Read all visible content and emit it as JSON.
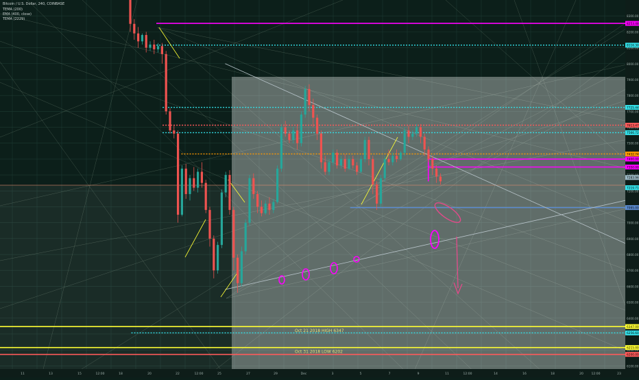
{
  "header": {
    "symbol_line": "Bitcoin / U.S. Dollar, 240, COINBASE",
    "indicators": [
      "TEMA (200)",
      "EMA (400, close)",
      "TEMA (2229)"
    ]
  },
  "colors": {
    "background": "#0c1f1a",
    "up": "#26a69a",
    "down": "#ef5350",
    "magenta": "#ff00ff",
    "cyan": "#33e0e8",
    "yellow": "#ffff33",
    "orange": "#ff9900",
    "red_dotted": "#ff5a5a",
    "blue_line": "#5b8bd0",
    "annotation": "#e34a8a",
    "panel": "#ffffff"
  },
  "chart_data": {
    "type": "candlestick",
    "price_axis_ticks": [
      "8300.00",
      "8200.00",
      "8100.00",
      "8000.00",
      "7900.00",
      "7800.00",
      "7700.00",
      "7600.00",
      "7500.00",
      "7400.00",
      "7300.00",
      "7200.00",
      "7100.00",
      "7000.00",
      "6900.00",
      "6800.00",
      "6700.00",
      "6600.00",
      "6500.00",
      "6400.00",
      "6300.00",
      "6200.00",
      "6100.00"
    ],
    "time_axis_ticks": [
      "11",
      "13",
      "15",
      "12:00",
      "18",
      "20",
      "22",
      "12:00",
      "25",
      "27",
      "29",
      "Dec",
      "3",
      "5",
      "7",
      "9",
      "11",
      "12:00",
      "14",
      "16",
      "18",
      "20",
      "12:00",
      "23"
    ],
    "ylim": [
      6080,
      8400
    ],
    "price_labels": [
      {
        "text": "8253.48",
        "price": 8253,
        "color": "#ff00ff"
      },
      {
        "text": "8116.30",
        "price": 8116,
        "color": "#33e0e8"
      },
      {
        "text": "7725.44",
        "price": 7725,
        "color": "#33e0e8"
      },
      {
        "text": "7613.47",
        "price": 7613,
        "color": "#ff5a5a"
      },
      {
        "text": "7566.72",
        "price": 7566,
        "color": "#33e0e8"
      },
      {
        "text": "7432.74",
        "price": 7432,
        "color": "#ff9900"
      },
      {
        "text": "7400.00",
        "price": 7400,
        "color": "#ff00ff"
      },
      {
        "text": "7350.00",
        "price": 7350,
        "color": "#ff00ff"
      },
      {
        "text": "7283.96",
        "price": 7284,
        "color": "#9bb8c4"
      },
      {
        "text": "7219.71",
        "price": 7220,
        "color": "#33e0e8"
      },
      {
        "text": "7095.00",
        "price": 7095,
        "color": "#5b8bd0"
      },
      {
        "text": "6347.00",
        "price": 6347,
        "color": "#ffff33"
      },
      {
        "text": "6256.60",
        "price": 6307,
        "color": "#33e0e8"
      },
      {
        "text": "6215.00",
        "price": 6215,
        "color": "#ffff33"
      },
      {
        "text": "6200.00",
        "price": 6172,
        "color": "#ff5a5a"
      }
    ],
    "horizontal_levels": [
      {
        "name": "magenta-resistance",
        "price": 8253,
        "color": "#ff00ff",
        "style": "solid",
        "x_from": 0.25
      },
      {
        "name": "cyan-upper",
        "price": 8116,
        "color": "#33e0e8",
        "style": "dotted",
        "x_from": 0.25
      },
      {
        "name": "cyan-mid",
        "price": 7725,
        "color": "#33e0e8",
        "style": "dotted",
        "x_from": 0.26
      },
      {
        "name": "red-dotted",
        "price": 7613,
        "color": "#ff5a5a",
        "style": "dotted",
        "x_from": 0.26
      },
      {
        "name": "cyan-low",
        "price": 7566,
        "color": "#33e0e8",
        "style": "dotted",
        "x_from": 0.26
      },
      {
        "name": "orange-dotted",
        "price": 7432,
        "color": "#ff9900",
        "style": "dotted",
        "x_from": 0.29
      },
      {
        "name": "magenta-box-top",
        "price": 7400,
        "color": "#ff00ff",
        "style": "solid",
        "x_from": 0.685
      },
      {
        "name": "magenta-box-bottom",
        "price": 7350,
        "color": "#ff00ff",
        "style": "solid",
        "x_from": 0.685
      },
      {
        "name": "blue-support",
        "price": 7095,
        "color": "#5b8bd0",
        "style": "solid",
        "x_from": 0.56
      },
      {
        "name": "yellow-high",
        "price": 6347,
        "color": "#ffff33",
        "style": "solid",
        "x_from": 0.0
      },
      {
        "name": "cyan-bottom",
        "price": 6307,
        "color": "#33e0e8",
        "style": "dotted",
        "x_from": 0.21
      },
      {
        "name": "yellow-low",
        "price": 6215,
        "color": "#ffff33",
        "style": "solid",
        "x_from": 0.0
      },
      {
        "name": "red-bottom",
        "price": 6172,
        "color": "#ff5a5a",
        "style": "solid",
        "x_from": 0.0
      }
    ],
    "level_annotations": [
      {
        "text": "Oct 21 2018 HIGH 6347",
        "price": 6347
      },
      {
        "text": "Oct 31 2018 LOW 6202",
        "price": 6215
      }
    ],
    "candles": [
      {
        "o": 8400,
        "h": 8420,
        "c": 8250,
        "l": 8200
      },
      {
        "o": 8250,
        "h": 8280,
        "c": 8190,
        "l": 8150
      },
      {
        "o": 8190,
        "h": 8230,
        "c": 8140,
        "l": 8100
      },
      {
        "o": 8140,
        "h": 8190,
        "c": 8180,
        "l": 8120
      },
      {
        "o": 8180,
        "h": 8200,
        "c": 8100,
        "l": 8070
      },
      {
        "o": 8100,
        "h": 8140,
        "c": 8120,
        "l": 8080
      },
      {
        "o": 8120,
        "h": 8150,
        "c": 8090,
        "l": 8060
      },
      {
        "o": 8090,
        "h": 8130,
        "c": 8110,
        "l": 8070
      },
      {
        "o": 8110,
        "h": 8130,
        "c": 8060,
        "l": 8000
      },
      {
        "o": 8060,
        "h": 8080,
        "c": 7700,
        "l": 7680
      },
      {
        "o": 7700,
        "h": 7720,
        "c": 7580,
        "l": 7560
      },
      {
        "o": 7580,
        "h": 7610,
        "c": 7560,
        "l": 7530
      },
      {
        "o": 7560,
        "h": 7580,
        "c": 7050,
        "l": 7000
      },
      {
        "o": 7050,
        "h": 7360,
        "c": 7340,
        "l": 7040
      },
      {
        "o": 7340,
        "h": 7370,
        "c": 7180,
        "l": 7150
      },
      {
        "o": 7180,
        "h": 7300,
        "c": 7280,
        "l": 7140
      },
      {
        "o": 7280,
        "h": 7350,
        "c": 7220,
        "l": 7200
      },
      {
        "o": 7220,
        "h": 7340,
        "c": 7320,
        "l": 7190
      },
      {
        "o": 7320,
        "h": 7380,
        "c": 7250,
        "l": 7220
      },
      {
        "o": 7250,
        "h": 7270,
        "c": 7080,
        "l": 7060
      },
      {
        "o": 7080,
        "h": 7100,
        "c": 6900,
        "l": 6850
      },
      {
        "o": 6900,
        "h": 6920,
        "c": 6700,
        "l": 6650
      },
      {
        "o": 6700,
        "h": 6880,
        "c": 6860,
        "l": 6680
      },
      {
        "o": 6860,
        "h": 7210,
        "c": 7190,
        "l": 6840
      },
      {
        "o": 7190,
        "h": 7320,
        "c": 7300,
        "l": 7160
      },
      {
        "o": 7300,
        "h": 7330,
        "c": 7080,
        "l": 7050
      },
      {
        "o": 7080,
        "h": 7100,
        "c": 6780,
        "l": 6700
      },
      {
        "o": 6780,
        "h": 6800,
        "c": 6620,
        "l": 6560
      },
      {
        "o": 6620,
        "h": 6850,
        "c": 6820,
        "l": 6600
      },
      {
        "o": 6820,
        "h": 7020,
        "c": 7000,
        "l": 6800
      },
      {
        "o": 7000,
        "h": 7300,
        "c": 7280,
        "l": 6980
      },
      {
        "o": 7280,
        "h": 7310,
        "c": 7180,
        "l": 7150
      },
      {
        "o": 7180,
        "h": 7200,
        "c": 7100,
        "l": 7060
      },
      {
        "o": 7100,
        "h": 7140,
        "c": 7060,
        "l": 7040
      },
      {
        "o": 7060,
        "h": 7140,
        "c": 7120,
        "l": 7050
      },
      {
        "o": 7120,
        "h": 7160,
        "c": 7080,
        "l": 7050
      },
      {
        "o": 7080,
        "h": 7150,
        "c": 7130,
        "l": 7060
      },
      {
        "o": 7130,
        "h": 7360,
        "c": 7340,
        "l": 7120
      },
      {
        "o": 7340,
        "h": 7620,
        "c": 7600,
        "l": 7320
      },
      {
        "o": 7600,
        "h": 7640,
        "c": 7560,
        "l": 7540
      },
      {
        "o": 7560,
        "h": 7580,
        "c": 7520,
        "l": 7500
      },
      {
        "o": 7520,
        "h": 7600,
        "c": 7580,
        "l": 7500
      },
      {
        "o": 7580,
        "h": 7620,
        "c": 7500,
        "l": 7460
      },
      {
        "o": 7500,
        "h": 7700,
        "c": 7680,
        "l": 7480
      },
      {
        "o": 7680,
        "h": 7860,
        "c": 7840,
        "l": 7660
      },
      {
        "o": 7840,
        "h": 7870,
        "c": 7740,
        "l": 7700
      },
      {
        "o": 7740,
        "h": 7780,
        "c": 7660,
        "l": 7600
      },
      {
        "o": 7660,
        "h": 7680,
        "c": 7560,
        "l": 7520
      },
      {
        "o": 7560,
        "h": 7580,
        "c": 7380,
        "l": 7340
      },
      {
        "o": 7380,
        "h": 7420,
        "c": 7320,
        "l": 7300
      },
      {
        "o": 7320,
        "h": 7400,
        "c": 7380,
        "l": 7300
      },
      {
        "o": 7380,
        "h": 7460,
        "c": 7440,
        "l": 7360
      },
      {
        "o": 7440,
        "h": 7460,
        "c": 7360,
        "l": 7340
      },
      {
        "o": 7360,
        "h": 7420,
        "c": 7400,
        "l": 7340
      },
      {
        "o": 7400,
        "h": 7430,
        "c": 7340,
        "l": 7320
      },
      {
        "o": 7340,
        "h": 7420,
        "c": 7400,
        "l": 7330
      },
      {
        "o": 7400,
        "h": 7420,
        "c": 7360,
        "l": 7340
      },
      {
        "o": 7360,
        "h": 7380,
        "c": 7320,
        "l": 7300
      },
      {
        "o": 7320,
        "h": 7420,
        "c": 7400,
        "l": 7310
      },
      {
        "o": 7400,
        "h": 7540,
        "c": 7520,
        "l": 7380
      },
      {
        "o": 7520,
        "h": 7540,
        "c": 7400,
        "l": 7360
      },
      {
        "o": 7400,
        "h": 7420,
        "c": 7240,
        "l": 7180
      },
      {
        "o": 7240,
        "h": 7260,
        "c": 7120,
        "l": 7080
      },
      {
        "o": 7120,
        "h": 7300,
        "c": 7280,
        "l": 7100
      },
      {
        "o": 7280,
        "h": 7420,
        "c": 7400,
        "l": 7260
      },
      {
        "o": 7400,
        "h": 7460,
        "c": 7380,
        "l": 7360
      },
      {
        "o": 7380,
        "h": 7440,
        "c": 7420,
        "l": 7360
      },
      {
        "o": 7420,
        "h": 7460,
        "c": 7400,
        "l": 7380
      },
      {
        "o": 7400,
        "h": 7450,
        "c": 7440,
        "l": 7390
      },
      {
        "o": 7440,
        "h": 7600,
        "c": 7580,
        "l": 7420
      },
      {
        "o": 7580,
        "h": 7610,
        "c": 7540,
        "l": 7500
      },
      {
        "o": 7540,
        "h": 7580,
        "c": 7560,
        "l": 7520
      },
      {
        "o": 7560,
        "h": 7620,
        "c": 7600,
        "l": 7540
      },
      {
        "o": 7600,
        "h": 7620,
        "c": 7540,
        "l": 7500
      },
      {
        "o": 7540,
        "h": 7560,
        "c": 7460,
        "l": 7420
      },
      {
        "o": 7460,
        "h": 7480,
        "c": 7400,
        "l": 7380
      },
      {
        "o": 7400,
        "h": 7420,
        "c": 7340,
        "l": 7300
      },
      {
        "o": 7340,
        "h": 7360,
        "c": 7290,
        "l": 7250
      },
      {
        "o": 7290,
        "h": 7310,
        "c": 7260,
        "l": 7240
      }
    ],
    "trendlines": [
      {
        "name": "ascending-support",
        "from": [
          0.36,
          6580
        ],
        "to": [
          1.0,
          7140
        ],
        "color": "#b7c3c9"
      },
      {
        "name": "descending-resistance",
        "from": [
          0.36,
          8000
        ],
        "to": [
          1.0,
          6870
        ],
        "color": "#b7c3c9"
      }
    ]
  }
}
